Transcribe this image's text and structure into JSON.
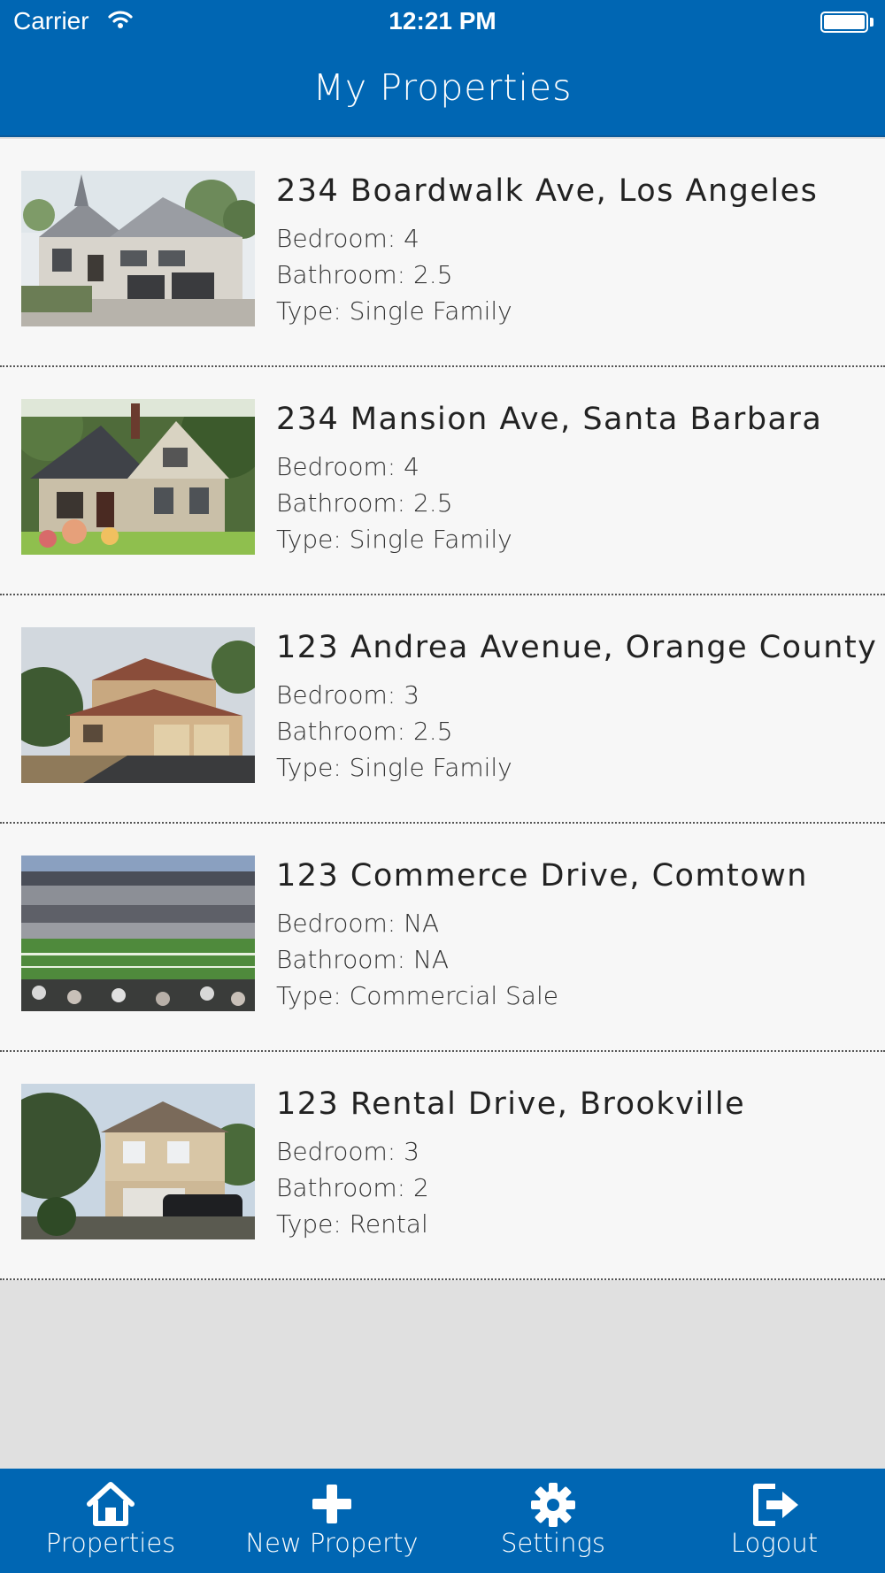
{
  "status_bar": {
    "carrier": "Carrier",
    "time": "12:21 PM"
  },
  "header": {
    "title": "My Properties"
  },
  "properties": [
    {
      "address": "234 Boardwalk Ave, Los Angeles",
      "bedroom": "Bedroom: 4",
      "bathroom": "Bathroom: 2.5",
      "type": "Type: Single Family",
      "photo": "white-mansion"
    },
    {
      "address": "234 Mansion Ave, Santa Barbara",
      "bedroom": "Bedroom: 4",
      "bathroom": "Bathroom: 2.5",
      "type": "Type: Single Family",
      "photo": "cottage-house"
    },
    {
      "address": "123 Andrea Avenue, Orange County",
      "bedroom": "Bedroom: 3",
      "bathroom": "Bathroom: 2.5",
      "type": "Type: Single Family",
      "photo": "brick-house"
    },
    {
      "address": "123 Commerce Drive, Comtown",
      "bedroom": "Bedroom: NA",
      "bathroom": "Bathroom: NA",
      "type": "Type: Commercial Sale",
      "photo": "stadium"
    },
    {
      "address": "123 Rental Drive, Brookville",
      "bedroom": "Bedroom: 3",
      "bathroom": "Bathroom: 2",
      "type": "Type: Rental",
      "photo": "rental-house"
    }
  ],
  "tabbar": {
    "tabs": [
      {
        "label": "Properties",
        "icon": "home-icon"
      },
      {
        "label": "New Property",
        "icon": "plus-icon"
      },
      {
        "label": "Settings",
        "icon": "gear-icon"
      },
      {
        "label": "Logout",
        "icon": "logout-icon"
      }
    ]
  },
  "colors": {
    "accent": "#0066b3",
    "row_bg": "#f7f7f7",
    "page_bg": "#e0e0e0"
  }
}
